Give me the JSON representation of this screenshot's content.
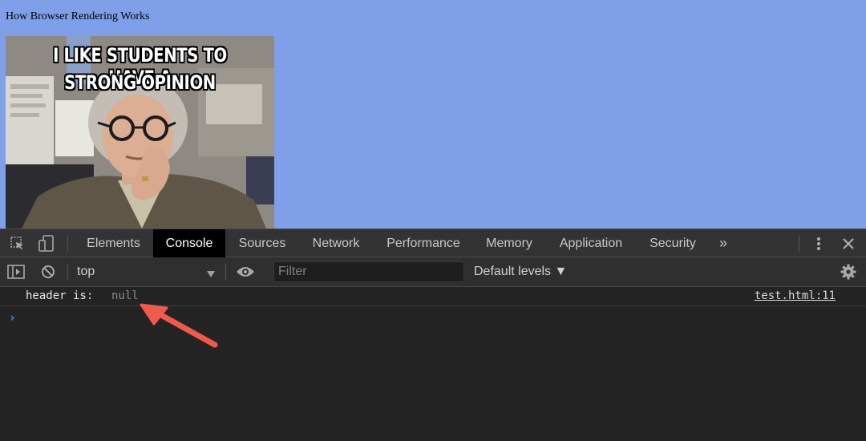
{
  "page": {
    "heading": "How Browser Rendering Works",
    "meme": {
      "caption_line1": "I LIKE STUDENTS TO HAVE A",
      "caption_line2": "STRONG OPINION"
    }
  },
  "devtools": {
    "tabs": [
      {
        "label": "Elements",
        "active": false
      },
      {
        "label": "Console",
        "active": true
      },
      {
        "label": "Sources",
        "active": false
      },
      {
        "label": "Network",
        "active": false
      },
      {
        "label": "Performance",
        "active": false
      },
      {
        "label": "Memory",
        "active": false
      },
      {
        "label": "Application",
        "active": false
      },
      {
        "label": "Security",
        "active": false
      }
    ],
    "more_tabs_label": "»",
    "toolbar": {
      "context": "top",
      "filter_placeholder": "Filter",
      "levels": "Default levels ▼"
    },
    "console": {
      "entries": [
        {
          "label": "header is:",
          "value": "null",
          "source": "test.html:11"
        }
      ],
      "prompt": "›"
    },
    "colors": {
      "page_bg": "#7f9fe9",
      "devtools_bg": "#242424",
      "active_tab_bg": "#000000",
      "prompt": "#4f8ef7",
      "annotation_arrow": "#f05a4a"
    },
    "icons": [
      "inspect-element-icon",
      "device-toolbar-icon",
      "kebab-menu-icon",
      "close-icon",
      "sidebar-toggle-icon",
      "clear-console-icon",
      "eye-icon",
      "gear-icon"
    ]
  }
}
